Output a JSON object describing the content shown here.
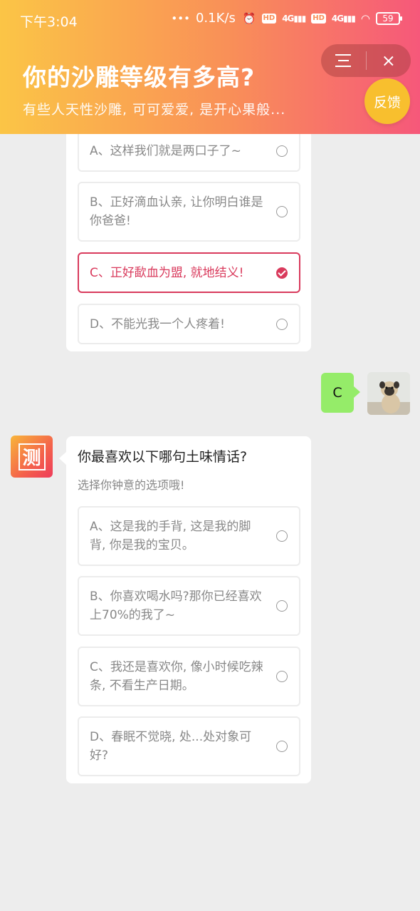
{
  "status_bar": {
    "time": "下午3:04",
    "net_speed": "0.1K/s",
    "battery": "59"
  },
  "header": {
    "title": "你的沙雕等级有多高?",
    "subtitle": "有些人天性沙雕, 可可爱爱, 是开心果般...",
    "feedback_label": "反馈",
    "menu_icon": "menu-icon",
    "close_icon": "close-icon"
  },
  "previous_question": {
    "options": [
      {
        "text": "A、这样我们就是两口子了~",
        "selected": false
      },
      {
        "text": "B、正好滴血认亲, 让你明白谁是你爸爸!",
        "selected": false
      },
      {
        "text": "C、正好歃血为盟, 就地结义!",
        "selected": true
      },
      {
        "text": "D、不能光我一个人疼着!",
        "selected": false
      }
    ]
  },
  "user_reply": {
    "text": "C"
  },
  "bot": {
    "avatar_label": "测"
  },
  "current_question": {
    "title": "你最喜欢以下哪句土味情话?",
    "hint": "选择你钟意的选项哦!",
    "options": [
      {
        "text": "A、这是我的手背, 这是我的脚背, 你是我的宝贝。",
        "selected": false
      },
      {
        "text": "B、你喜欢喝水吗?那你已经喜欢上70%的我了~",
        "selected": false
      },
      {
        "text": "C、我还是喜欢你, 像小时候吃辣条, 不看生产日期。",
        "selected": false
      },
      {
        "text": "D、春眠不觉晓, 处...处对象可好?",
        "selected": false
      }
    ]
  },
  "colors": {
    "header_gradient_start": "#fbc546",
    "header_gradient_end": "#f6587a",
    "feedback_button": "#f8bf2e",
    "selected_accent": "#d93a5c",
    "reply_bubble": "#95ec69",
    "background": "#ededed"
  }
}
